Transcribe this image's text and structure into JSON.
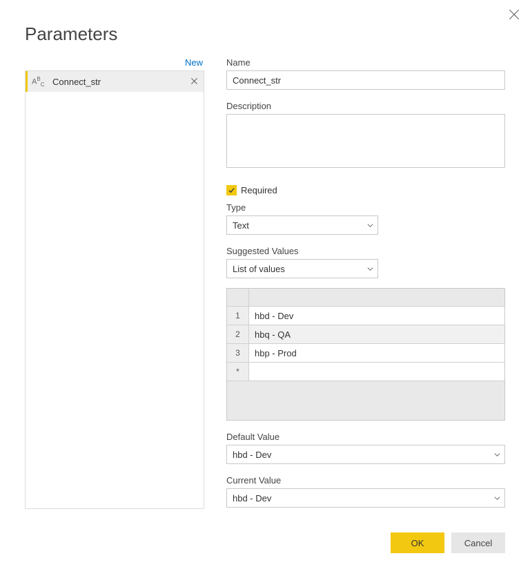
{
  "title": "Parameters",
  "left": {
    "new_label": "New",
    "items": [
      {
        "type_glyph": "ABC",
        "name": "Connect_str"
      }
    ]
  },
  "form": {
    "name_label": "Name",
    "name_value": "Connect_str",
    "description_label": "Description",
    "description_value": "",
    "required_label": "Required",
    "required_checked": true,
    "type_label": "Type",
    "type_value": "Text",
    "suggested_label": "Suggested Values",
    "suggested_value": "List of values",
    "values": [
      {
        "n": "1",
        "v": "hbd - Dev"
      },
      {
        "n": "2",
        "v": "hbq - QA"
      },
      {
        "n": "3",
        "v": "hbp - Prod"
      }
    ],
    "new_row_marker": "*",
    "default_label": "Default Value",
    "default_value": "hbd - Dev",
    "current_label": "Current Value",
    "current_value": "hbd - Dev"
  },
  "buttons": {
    "ok": "OK",
    "cancel": "Cancel"
  }
}
